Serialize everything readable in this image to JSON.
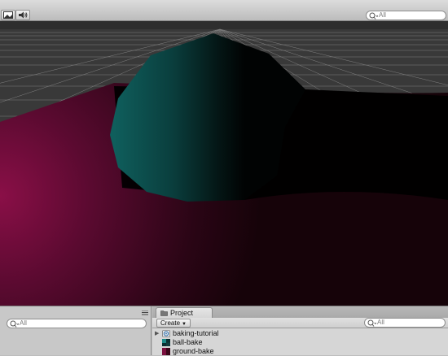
{
  "toolbar": {
    "buttons": [
      {
        "name": "scene-view-image-icon"
      },
      {
        "name": "speaker-icon"
      }
    ],
    "search": {
      "placeholder": "All"
    }
  },
  "hierarchy": {
    "search": {
      "placeholder": "All"
    }
  },
  "project": {
    "tab_label": "Project",
    "create_label": "Create",
    "search": {
      "placeholder": "All"
    },
    "items": [
      {
        "label": "baking-tutorial",
        "icon": "unity-scene-icon",
        "expandable": true
      },
      {
        "label": "ball-bake",
        "icon": "texture-icon",
        "expandable": false
      },
      {
        "label": "ground-bake",
        "icon": "texture-icon",
        "expandable": false
      }
    ]
  },
  "colors": {
    "ground_glow": "#8a0f47",
    "sphere": "#0f5a58",
    "grid": "#8c8c8c",
    "panel": "#c2c2c2"
  }
}
